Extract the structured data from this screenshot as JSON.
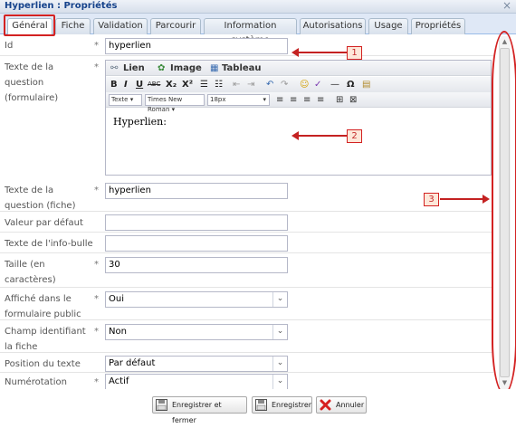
{
  "window": {
    "title": "Hyperlien : Propriétés",
    "close_glyph": "×"
  },
  "tabs": [
    {
      "label": "Général"
    },
    {
      "label": "Fiche"
    },
    {
      "label": "Validation"
    },
    {
      "label": "Parcourir"
    },
    {
      "label": "Information système"
    },
    {
      "label": "Autorisations"
    },
    {
      "label": "Usage"
    },
    {
      "label": "Propriétés"
    }
  ],
  "form": {
    "id": {
      "label": "Id",
      "required": "*",
      "value": "hyperlien"
    },
    "question_form": {
      "label": "Texte de la question (formulaire)",
      "required": "*"
    },
    "question_fiche": {
      "label": "Texte de la question (fiche)",
      "required": "*",
      "value": "hyperlien"
    },
    "default_value": {
      "label": "Valeur par défaut",
      "value": ""
    },
    "tooltip": {
      "label": "Texte de l'info-bulle",
      "value": ""
    },
    "size": {
      "label": "Taille (en caractères)",
      "required": "*",
      "value": "30"
    },
    "public": {
      "label": "Affiché dans le formulaire public",
      "required": "*",
      "value": "Oui"
    },
    "identifier": {
      "label": "Champ identifiant la fiche",
      "required": "*",
      "value": "Non"
    },
    "text_position": {
      "label": "Position du texte",
      "value": "Par défaut"
    },
    "numbering": {
      "label": "Numérotation",
      "required": "*",
      "value": "Actif"
    }
  },
  "editor": {
    "toolbar1": {
      "link": "Lien",
      "image": "Image",
      "table": "Tableau"
    },
    "toolbar3": {
      "style": "Texte",
      "font": "Times New Roman",
      "size": "18px"
    },
    "content": "Hyperlien:"
  },
  "callouts": {
    "one": "1",
    "two": "2",
    "three": "3"
  },
  "footer": {
    "save_close": "Enregistrer et fermer",
    "save": "Enregistrer",
    "cancel": "Annuler"
  },
  "colors": {
    "annotation_red": "#d32222",
    "tab_bg": "#dfe8f6",
    "title_blue": "#15428b"
  },
  "icons": [
    "close-icon",
    "link-icon",
    "image-icon",
    "table-icon",
    "save-close-icon",
    "save-icon",
    "cancel-icon",
    "chevron-down-icon"
  ]
}
